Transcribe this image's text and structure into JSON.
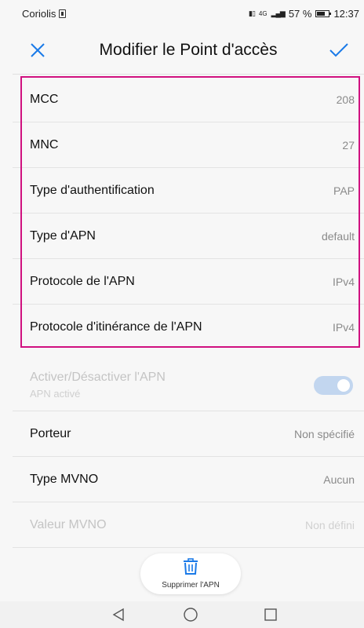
{
  "status_bar": {
    "carrier": "Coriolis",
    "signal_text": "4G",
    "battery_percent": "57 %",
    "time": "12:37"
  },
  "header": {
    "title": "Modifier le Point d'accès",
    "cancel_icon": "close-icon",
    "confirm_icon": "check-icon"
  },
  "rows": [
    {
      "label": "MCC",
      "value": "208"
    },
    {
      "label": "MNC",
      "value": "27"
    },
    {
      "label": "Type d'authentification",
      "value": "PAP"
    },
    {
      "label": "Type d'APN",
      "value": "default"
    },
    {
      "label": "Protocole de l'APN",
      "value": "IPv4"
    },
    {
      "label": "Protocole d'itinérance de l'APN",
      "value": "IPv4"
    }
  ],
  "toggle": {
    "title": "Activer/Désactiver l'APN",
    "subtitle": "APN activé",
    "enabled": true
  },
  "bearer": {
    "label": "Porteur",
    "value": "Non spécifié"
  },
  "mvno_type": {
    "label": "Type MVNO",
    "value": "Aucun"
  },
  "mvno_value": {
    "label": "Valeur MVNO",
    "value": "Non défini"
  },
  "delete_button": {
    "label": "Supprimer l'APN",
    "icon": "trash-icon"
  },
  "colors": {
    "accent": "#1a7ae8",
    "highlight": "#d0107f",
    "toggle_bg": "#c2d6ef"
  },
  "nav_bar": {
    "back_icon": "back-icon",
    "home_icon": "home-icon",
    "recents_icon": "recents-icon"
  }
}
